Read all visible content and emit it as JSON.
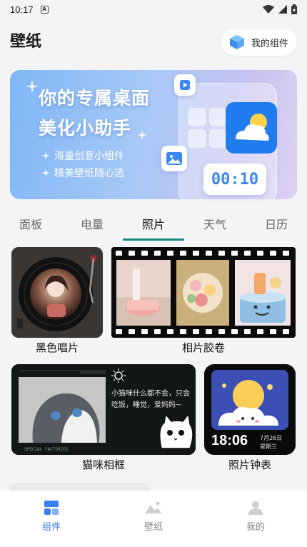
{
  "status_bar": {
    "time": "10:17",
    "notif_letter": "A"
  },
  "header": {
    "title": "壁纸",
    "my_widgets_label": "我的组件"
  },
  "banner": {
    "headline_1": "你的专属桌面",
    "headline_2": "美化小助手",
    "bullet_1": "海量创意小组件",
    "bullet_2": "精美壁纸随心选",
    "clock_text": "00:10"
  },
  "tabs": [
    {
      "label": "面板"
    },
    {
      "label": "电量"
    },
    {
      "label": "照片"
    },
    {
      "label": "天气"
    },
    {
      "label": "日历"
    }
  ],
  "active_tab": "照片",
  "widgets": [
    {
      "caption": "黑色唱片"
    },
    {
      "caption": "相片胶卷"
    },
    {
      "caption": "猫咪相框",
      "note_text": "小猫咪什么都不会，只会吃饭，睡觉，爱妈妈~",
      "footer_text": "SPECIAL FACTORIES"
    },
    {
      "caption": "照片钟表",
      "time": "18:06",
      "date": "7月26日",
      "weekday": "星期三"
    }
  ],
  "bottom_nav": [
    {
      "label": "组件"
    },
    {
      "label": "壁纸"
    },
    {
      "label": "我的"
    }
  ],
  "colors": {
    "accent": "#3b7cf0",
    "tab_indicator": "#128a7c",
    "banner_start": "#7fb6f7",
    "banner_end": "#dcd2f4"
  }
}
